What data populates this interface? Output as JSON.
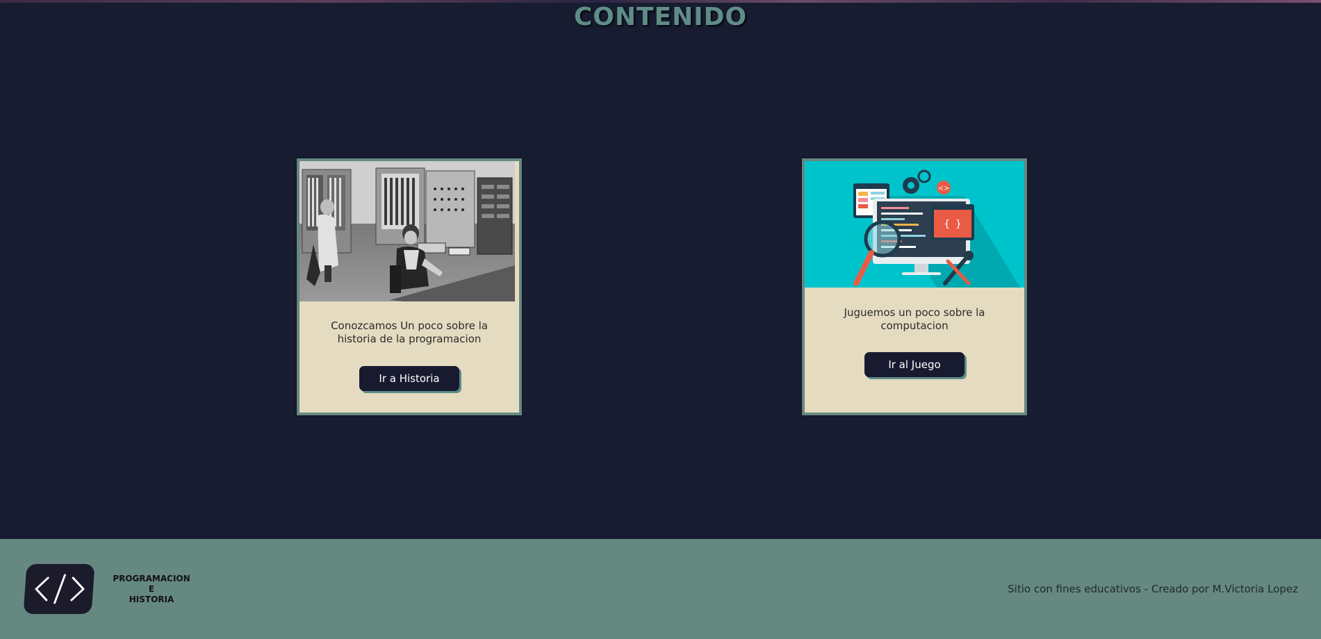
{
  "header": {
    "title": "CONTENIDO"
  },
  "cards": [
    {
      "image_icon": "vintage-computer-photo",
      "text": "Conozcamos Un poco sobre la historia de la programacion",
      "button_label": "Ir a Historia"
    },
    {
      "image_icon": "computer-code-illustration",
      "text": "Juguemos un poco sobre la computacion",
      "button_label": "Ir al Juego"
    }
  ],
  "footer": {
    "logo_icon": "code-brackets-icon",
    "brand_lines": [
      "PROGRAMACION",
      "E",
      "HISTORIA"
    ],
    "credit": "Sitio con fines educativos - Creado por M.Victoria Lopez"
  },
  "colors": {
    "background": "#171c30",
    "accent": "#658880",
    "card_background": "#e5dbc1",
    "button_background": "#181b30",
    "illustration_background": "#00c4cc"
  }
}
